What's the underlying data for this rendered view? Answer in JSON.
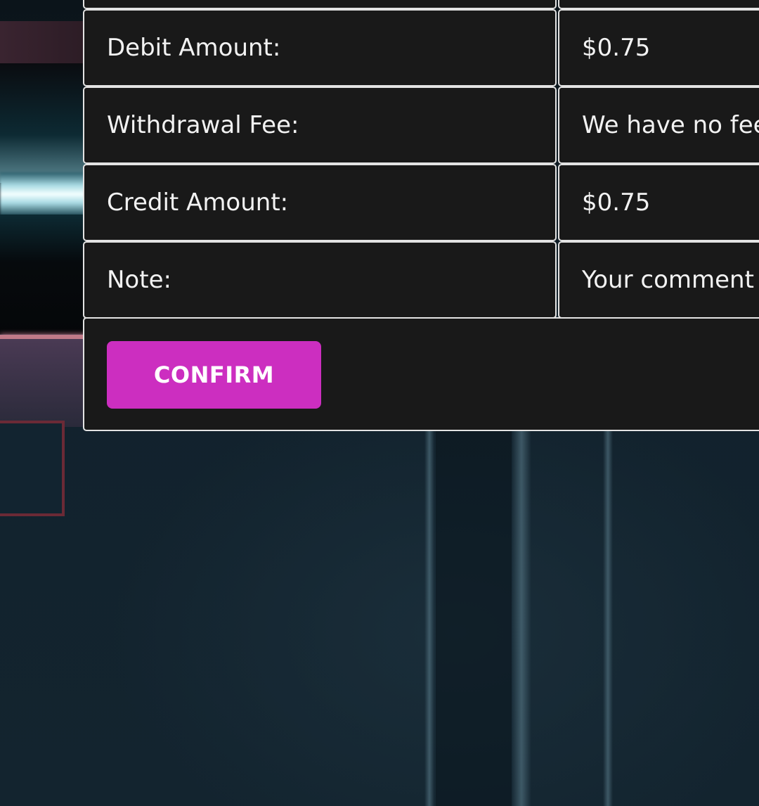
{
  "details": {
    "rows": [
      {
        "label": "Debit Amount:",
        "value": "$0.75"
      },
      {
        "label": "Withdrawal Fee:",
        "value": "We have no fee t"
      },
      {
        "label": "Credit Amount:",
        "value": "$0.75"
      },
      {
        "label": "Note:",
        "value": "Your comment"
      }
    ]
  },
  "actions": {
    "confirm_label": "CONFIRM"
  },
  "colors": {
    "accent": "#cc2ec0",
    "cell_background": "#191919",
    "cell_border": "#e3e3e3",
    "text": "#f2f2f2"
  }
}
